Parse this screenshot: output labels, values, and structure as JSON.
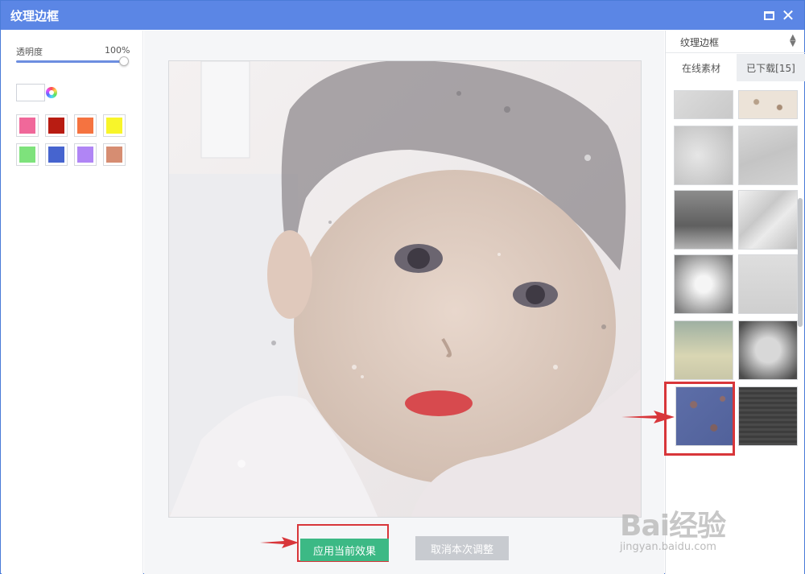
{
  "window": {
    "title": "纹理边框"
  },
  "left_panel": {
    "opacity_label": "透明度",
    "opacity_value": "100%",
    "opacity_level": 1.0,
    "swatches": [
      "#f0689a",
      "#b81c12",
      "#f57340",
      "#f8f52a",
      "#7ee27c",
      "#4664cf",
      "#b085f5",
      "#d68d72"
    ]
  },
  "right_panel": {
    "dropdown_value": "纹理边框",
    "tabs": {
      "online": "在线素材",
      "downloaded": "已下载[15]"
    }
  },
  "actions": {
    "apply": "应用当前效果",
    "cancel": "取消本次调整"
  },
  "watermark": {
    "brand": "Bai经验",
    "url": "jingyan.baidu.com"
  }
}
